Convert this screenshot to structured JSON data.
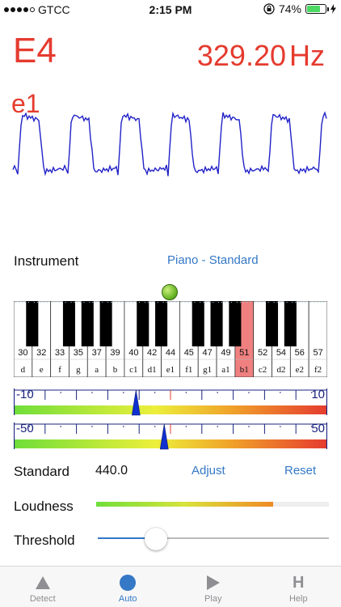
{
  "status": {
    "carrier": "GTCC",
    "time": "2:15 PM",
    "battery": "74%"
  },
  "note": {
    "name": "E4",
    "alt_name": "e1",
    "frequency": "329.20",
    "unit": "Hz"
  },
  "instrument": {
    "label": "Instrument",
    "value": "Piano - Standard"
  },
  "piano": {
    "active_index": 12,
    "numbers": [
      "30",
      "32",
      "33",
      "35",
      "37",
      "39",
      "40",
      "42",
      "44",
      "45",
      "47",
      "49",
      "51",
      "52",
      "54",
      "56",
      "57"
    ],
    "notes": [
      "d",
      "e",
      "f",
      "g",
      "a",
      "b",
      "c1",
      "d1",
      "e1",
      "f1",
      "g1",
      "a1",
      "b1",
      "c2",
      "d2",
      "e2",
      "f2"
    ],
    "highlight_number": "44",
    "highlight_note": "e1"
  },
  "meter_fine": {
    "min_label": "-10",
    "max_label": "10",
    "level": 0.39
  },
  "meter_coarse": {
    "min_label": "-50",
    "max_label": "50",
    "level": 0.48
  },
  "standard": {
    "label": "Standard",
    "value": "440.0",
    "adjust": "Adjust",
    "reset": "Reset"
  },
  "loudness": {
    "label": "Loudness",
    "level": 0.76
  },
  "threshold": {
    "label": "Threshold",
    "level": 0.25
  },
  "tabs": [
    {
      "label": "Detect",
      "icon": "triangle-up-icon"
    },
    {
      "label": "Auto",
      "icon": "circle-icon"
    },
    {
      "label": "Play",
      "icon": "play-icon"
    },
    {
      "label": "Help",
      "icon": "help-letter-icon"
    }
  ],
  "colors": {
    "accent": "#3478c6",
    "note_red": "#e53b2f",
    "wave_blue": "#2222c8",
    "meter_navy": "#1a237e"
  }
}
